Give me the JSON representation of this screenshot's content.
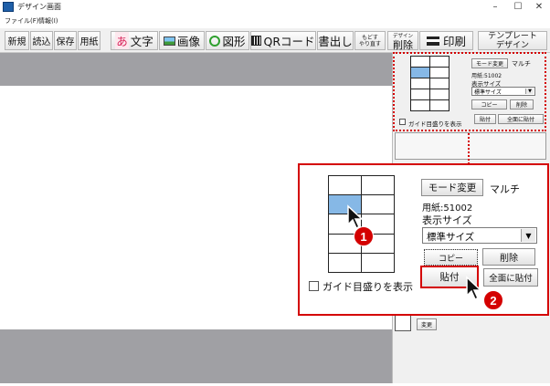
{
  "window": {
    "title": "デザイン画面",
    "controls": {
      "minimize": "–",
      "maximize": "☐",
      "close": "✕"
    }
  },
  "menu": [
    "ファイル(F)",
    "情報(I)"
  ],
  "toolbar": {
    "new": "新規",
    "load": "読込",
    "save": "保存",
    "paper": "用紙",
    "text_icon": "あ",
    "text": "文字",
    "image": "画像",
    "shape": "図形",
    "qr": "QRコード",
    "write": "書出し",
    "undo_line1": "もどす",
    "undo_line2": "やり直す",
    "delete_line1": "デザイン",
    "delete_line2": "削除",
    "print": "印刷",
    "template_line1": "テンプレート",
    "template_line2": "デザイン"
  },
  "panel": {
    "mode_button": "モード変更",
    "mode_value": "マルチ",
    "paper_label": "用紙:51002",
    "size_label": "表示サイズ",
    "size_value": "標準サイズ",
    "copy_button": "コピー",
    "delete_button": "削除",
    "paste_button": "貼付",
    "paste_all_button": "全面に貼付",
    "guide_label": "ガイド目盛りを表示",
    "change_button": "変更"
  },
  "callouts": {
    "step1": "1",
    "step2": "2"
  },
  "colors": {
    "selected_cell": "#86b8e6",
    "highlight": "#d40000"
  }
}
